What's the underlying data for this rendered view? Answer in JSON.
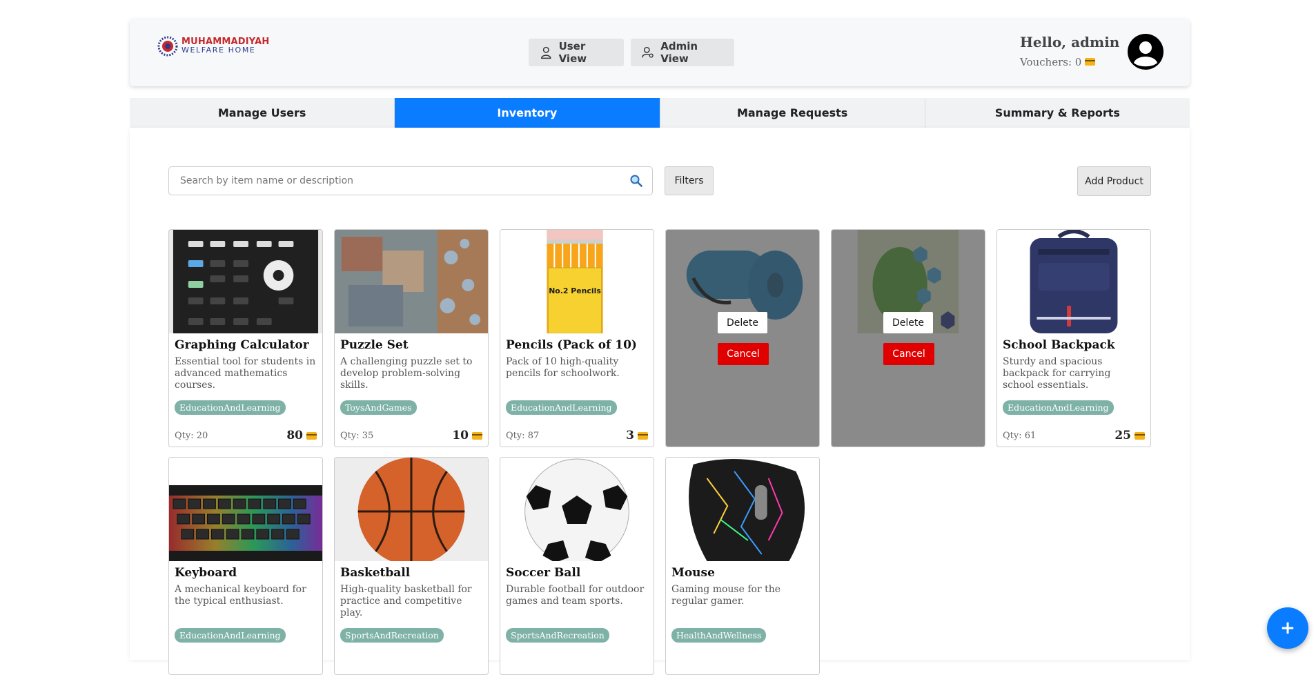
{
  "header": {
    "logo": {
      "line1": "MUHAMMADIYAH",
      "line2": "WELFARE HOME"
    },
    "user_view_label": "User View",
    "admin_view_label": "Admin View",
    "greeting": "Hello, admin",
    "vouchers": "Vouchers: 0"
  },
  "tabs": [
    {
      "label": "Manage Users"
    },
    {
      "label": "Inventory"
    },
    {
      "label": "Manage Requests"
    },
    {
      "label": "Summary & Reports"
    }
  ],
  "toolbar": {
    "search_placeholder": "Search by item name or description",
    "filters_label": "Filters",
    "add_product_label": "Add Product"
  },
  "products": [
    {
      "name": "Graphing Calculator",
      "description": "Essential tool for students in advanced mathematics courses.",
      "category": "EducationAndLearning",
      "qty": "Qty: 20",
      "price": "80"
    },
    {
      "name": "Puzzle Set",
      "description": "A challenging puzzle set to develop problem-solving skills.",
      "category": "ToysAndGames",
      "qty": "Qty: 35",
      "price": "10"
    },
    {
      "name": "Pencils (Pack of 10)",
      "description": "Pack of 10 high-quality pencils for schoolwork.",
      "category": "EducationAndLearning",
      "qty": "Qty: 87",
      "price": "3"
    },
    {
      "image": "yoga-mat",
      "delete_label": "Delete",
      "cancel_label": "Cancel"
    },
    {
      "image": "math-textbook",
      "delete_label": "Delete",
      "cancel_label": "Cancel"
    },
    {
      "name": "School Backpack",
      "description": "Sturdy and spacious backpack for carrying school essentials.",
      "category": "EducationAndLearning",
      "qty": "Qty: 61",
      "price": "25"
    },
    {
      "name": "Keyboard",
      "description": "A mechanical keyboard for the typical enthusiast.",
      "category": "EducationAndLearning"
    },
    {
      "name": "Basketball",
      "description": "High-quality basketball for practice and competitive play.",
      "category": "SportsAndRecreation"
    },
    {
      "name": "Soccer Ball",
      "description": "Durable football for outdoor games and team sports.",
      "category": "SportsAndRecreation"
    },
    {
      "name": "Mouse",
      "description": "Gaming mouse for the regular gamer.",
      "category": "HealthAndWellness"
    }
  ],
  "pencil_box_text": "No.2 Pencils",
  "fab_label": "+",
  "icons": [
    "user-icon",
    "user-cog-icon",
    "avatar-icon",
    "search-icon",
    "voucher-card-icon"
  ],
  "colors": {
    "accent": "#0a7cff",
    "badge": "#7fb2a6",
    "danger": "#e00000"
  }
}
